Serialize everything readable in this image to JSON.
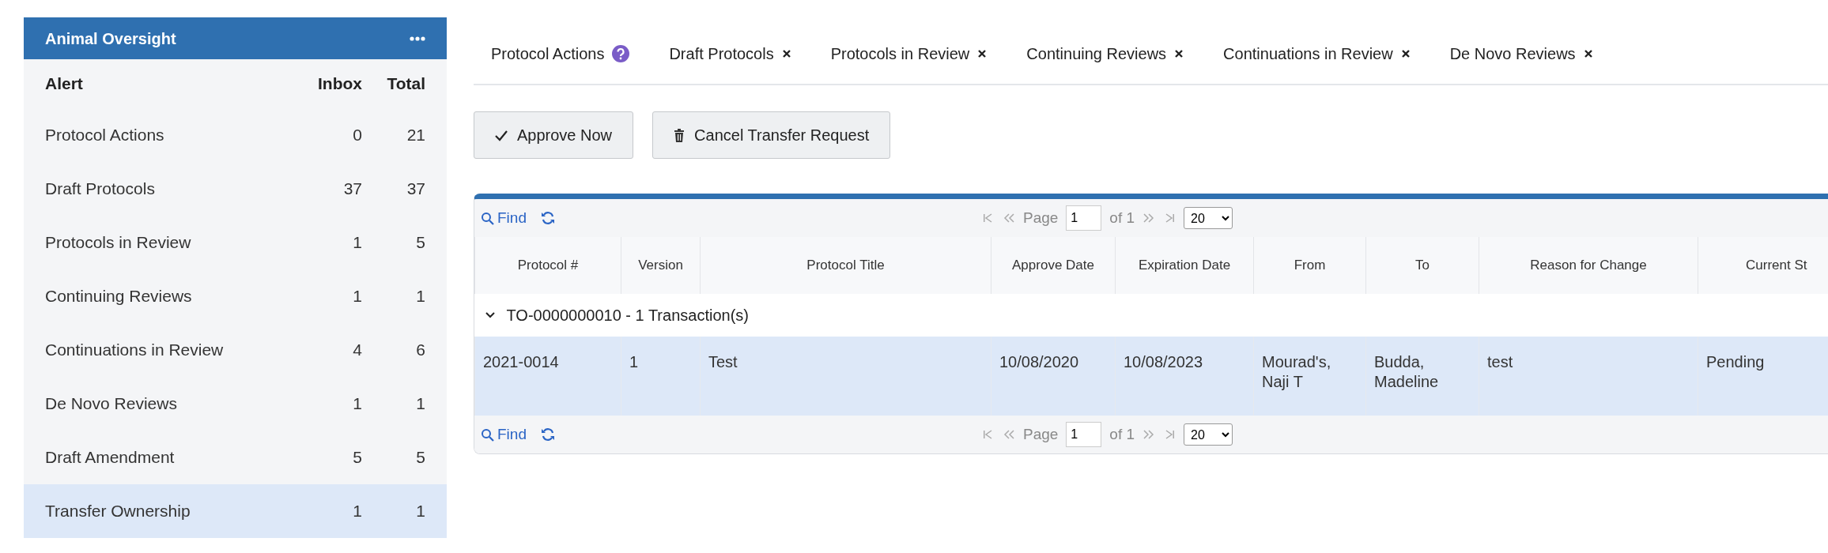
{
  "panel": {
    "title": "Animal Oversight",
    "columns": [
      "Alert",
      "Inbox",
      "Total"
    ],
    "rows": [
      {
        "alert": "Protocol Actions",
        "inbox": "0",
        "total": "21",
        "selected": false
      },
      {
        "alert": "Draft Protocols",
        "inbox": "37",
        "total": "37",
        "selected": false
      },
      {
        "alert": "Protocols in Review",
        "inbox": "1",
        "total": "5",
        "selected": false
      },
      {
        "alert": "Continuing Reviews",
        "inbox": "1",
        "total": "1",
        "selected": false
      },
      {
        "alert": "Continuations in Review",
        "inbox": "4",
        "total": "6",
        "selected": false
      },
      {
        "alert": "De Novo Reviews",
        "inbox": "1",
        "total": "1",
        "selected": false
      },
      {
        "alert": "Draft Amendment",
        "inbox": "5",
        "total": "5",
        "selected": false
      },
      {
        "alert": "Transfer Ownership",
        "inbox": "1",
        "total": "1",
        "selected": true
      }
    ]
  },
  "tabs": [
    {
      "label": "Protocol Actions",
      "kind": "help"
    },
    {
      "label": "Draft Protocols",
      "kind": "closable"
    },
    {
      "label": "Protocols in Review",
      "kind": "closable"
    },
    {
      "label": "Continuing Reviews",
      "kind": "closable"
    },
    {
      "label": "Continuations in Review",
      "kind": "closable"
    },
    {
      "label": "De Novo Reviews",
      "kind": "closable"
    }
  ],
  "buttons": [
    {
      "label": "Approve Now",
      "kind": "approve"
    },
    {
      "label": "Cancel Transfer Request",
      "kind": "cancel"
    }
  ],
  "grid": {
    "top_toolbar": {
      "find": "Find",
      "page_label": "Page",
      "page": "1",
      "of": "of 1",
      "page_size": "20"
    },
    "columns": [
      "Protocol #",
      "Version",
      "Protocol Title",
      "Approve Date",
      "Expiration Date",
      "From",
      "To",
      "Reason for Change",
      "Current St"
    ],
    "group": {
      "label": "TO-0000000010 - 1 Transaction(s)",
      "expanded": true
    },
    "rows": [
      {
        "cells": [
          "2021-0014",
          "1",
          "Test",
          "10/08/2020",
          "10/08/2023",
          "Mourad's, Naji T",
          "Budda, Madeline",
          "test",
          "Pending"
        ],
        "selected": true
      }
    ],
    "bottom_toolbar": {
      "find": "Find",
      "page_label": "Page",
      "page": "1",
      "of": "of 1",
      "page_size": "20"
    }
  }
}
